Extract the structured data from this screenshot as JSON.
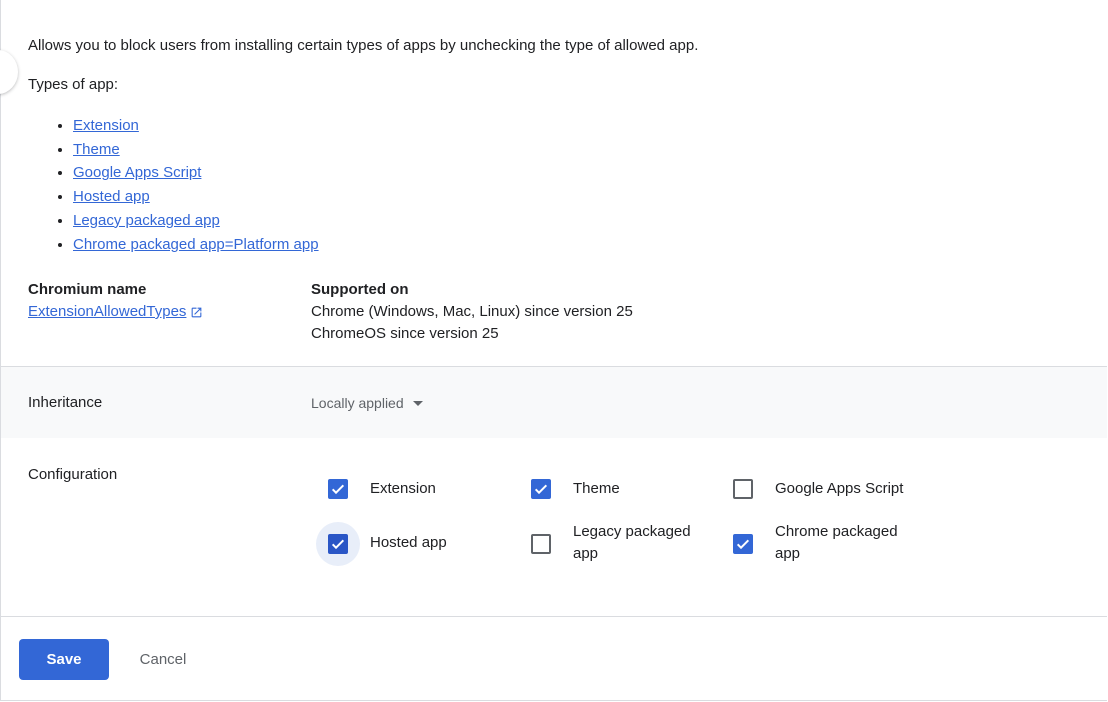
{
  "description": "Allows you to block users from installing certain types of apps by unchecking the type of allowed app.",
  "types_title": "Types of app:",
  "types": [
    "Extension",
    "Theme",
    "Google Apps Script",
    "Hosted app",
    "Legacy packaged app",
    "Chrome packaged app=Platform app"
  ],
  "chromium": {
    "label": "Chromium name",
    "link": "ExtensionAllowedTypes",
    "icon": "open-in-new-icon"
  },
  "supported": {
    "label": "Supported on",
    "lines": [
      "Chrome (Windows, Mac, Linux) since version 25",
      "ChromeOS since version 25"
    ]
  },
  "inheritance": {
    "label": "Inheritance",
    "value": "Locally applied",
    "icon": "arrow-drop-down-icon"
  },
  "configuration": {
    "label": "Configuration",
    "options": [
      {
        "line1": "Extension",
        "line2": "",
        "checked": true
      },
      {
        "line1": "Theme",
        "line2": "",
        "checked": true
      },
      {
        "line1": "Google Apps Script",
        "line2": "",
        "checked": false
      },
      {
        "line1": "Hosted app",
        "line2": "",
        "checked": true
      },
      {
        "line1": "Legacy packaged",
        "line2": "app",
        "checked": false
      },
      {
        "line1": "Chrome packaged",
        "line2": "app",
        "checked": true
      }
    ]
  },
  "footer": {
    "save": "Save",
    "cancel": "Cancel"
  },
  "colors": {
    "accent": "#3367d6",
    "text": "#202124",
    "muted": "#5f6368",
    "section_bg": "#f8f9fa"
  }
}
